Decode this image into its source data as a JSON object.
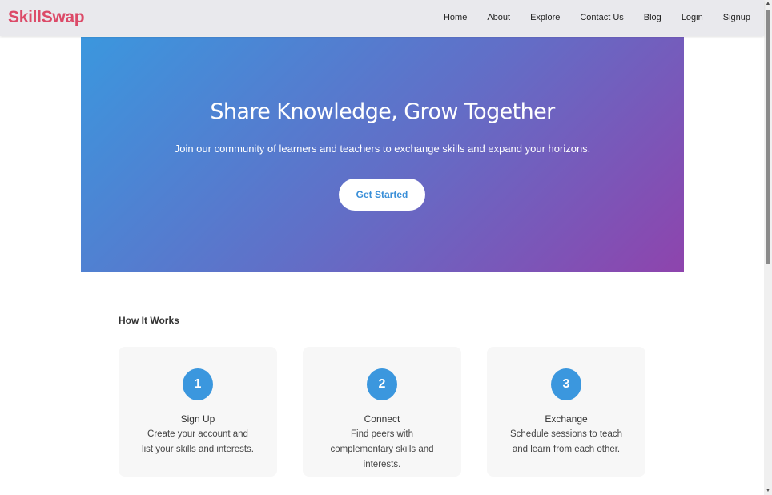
{
  "nav": {
    "brand": "SkillSwap",
    "links": [
      "Home",
      "About",
      "Explore",
      "Contact Us",
      "Blog",
      "Login",
      "Signup"
    ]
  },
  "hero": {
    "title": "Share Knowledge, Grow Together",
    "subtitle": "Join our community of learners and teachers to exchange skills and expand your horizons.",
    "button": "Get Started"
  },
  "how_it_works": {
    "title": "How It Works",
    "steps": [
      {
        "number": "1",
        "title": "Sign Up",
        "desc": "Create your account and list your skills and interests."
      },
      {
        "number": "2",
        "title": "Connect",
        "desc": "Find peers with complementary skills and interests."
      },
      {
        "number": "3",
        "title": "Exchange",
        "desc": "Schedule sessions to teach and learn from each other."
      }
    ]
  },
  "colors": {
    "brand": "#dc4a68",
    "accent": "#3b97de",
    "gradient_start": "#3b97de",
    "gradient_end": "#8e44ad"
  },
  "icons": {
    "scroll_up": "triangle-up",
    "scroll_down": "triangle-down"
  }
}
